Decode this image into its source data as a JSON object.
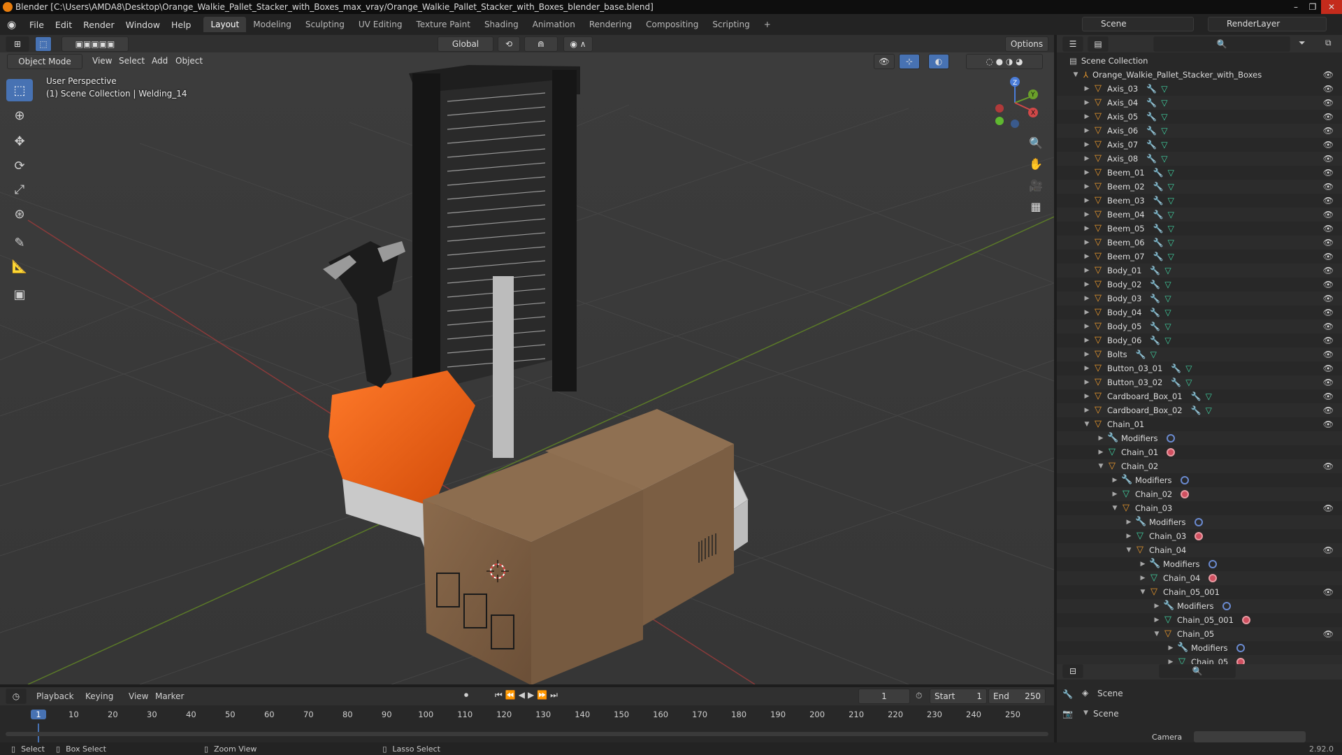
{
  "window": {
    "title": "Blender [C:\\Users\\AMDA8\\Desktop\\Orange_Walkie_Pallet_Stacker_with_Boxes_max_vray/Orange_Walkie_Pallet_Stacker_with_Boxes_blender_base.blend]",
    "controls": [
      "–",
      "❐",
      "✕"
    ]
  },
  "menu": [
    "File",
    "Edit",
    "Render",
    "Window",
    "Help"
  ],
  "workspaces": [
    "Layout",
    "Modeling",
    "Sculpting",
    "UV Editing",
    "Texture Paint",
    "Shading",
    "Animation",
    "Rendering",
    "Compositing",
    "Scripting"
  ],
  "active_workspace": "Layout",
  "scene_name": "Scene",
  "render_layer": "RenderLayer",
  "tool_header": {
    "orientation": "Global",
    "options_label": "Options"
  },
  "viewport_header": {
    "mode": "Object Mode",
    "menus": [
      "View",
      "Select",
      "Add",
      "Object"
    ]
  },
  "viewport": {
    "perspective_label": "User Perspective",
    "collection_label": "(1) Scene Collection | Welding_14",
    "gizmo_axes": [
      "Z",
      "Y",
      "X"
    ]
  },
  "outliner": {
    "root": "Scene Collection",
    "collection": "Orange_Walkie_Pallet_Stacker_with_Boxes",
    "rows": [
      {
        "label": "Axis_03",
        "kind": "obj",
        "level": 0,
        "open": false
      },
      {
        "label": "Axis_04",
        "kind": "obj",
        "level": 0,
        "open": false
      },
      {
        "label": "Axis_05",
        "kind": "obj",
        "level": 0,
        "open": false
      },
      {
        "label": "Axis_06",
        "kind": "obj",
        "level": 0,
        "open": false
      },
      {
        "label": "Axis_07",
        "kind": "obj",
        "level": 0,
        "open": false
      },
      {
        "label": "Axis_08",
        "kind": "obj",
        "level": 0,
        "open": false
      },
      {
        "label": "Beem_01",
        "kind": "obj",
        "level": 0,
        "open": false
      },
      {
        "label": "Beem_02",
        "kind": "obj",
        "level": 0,
        "open": false
      },
      {
        "label": "Beem_03",
        "kind": "obj",
        "level": 0,
        "open": false
      },
      {
        "label": "Beem_04",
        "kind": "obj",
        "level": 0,
        "open": false
      },
      {
        "label": "Beem_05",
        "kind": "obj",
        "level": 0,
        "open": false
      },
      {
        "label": "Beem_06",
        "kind": "obj",
        "level": 0,
        "open": false
      },
      {
        "label": "Beem_07",
        "kind": "obj",
        "level": 0,
        "open": false
      },
      {
        "label": "Body_01",
        "kind": "obj",
        "level": 0,
        "open": false
      },
      {
        "label": "Body_02",
        "kind": "obj",
        "level": 0,
        "open": false
      },
      {
        "label": "Body_03",
        "kind": "obj",
        "level": 0,
        "open": false
      },
      {
        "label": "Body_04",
        "kind": "obj",
        "level": 0,
        "open": false
      },
      {
        "label": "Body_05",
        "kind": "obj",
        "level": 0,
        "open": false
      },
      {
        "label": "Body_06",
        "kind": "obj",
        "level": 0,
        "open": false
      },
      {
        "label": "Bolts",
        "kind": "obj",
        "level": 0,
        "open": false
      },
      {
        "label": "Button_03_01",
        "kind": "obj",
        "level": 0,
        "open": false
      },
      {
        "label": "Button_03_02",
        "kind": "obj",
        "level": 0,
        "open": false
      },
      {
        "label": "Cardboard_Box_01",
        "kind": "obj",
        "level": 0,
        "open": false
      },
      {
        "label": "Cardboard_Box_02",
        "kind": "obj",
        "level": 0,
        "open": false
      },
      {
        "label": "Chain_01",
        "kind": "obj-open",
        "level": 0,
        "open": true
      },
      {
        "label": "Modifiers",
        "kind": "mods",
        "level": 1
      },
      {
        "label": "Chain_01",
        "kind": "mesh",
        "level": 1
      },
      {
        "label": "Chain_02",
        "kind": "obj-open",
        "level": 1,
        "open": true
      },
      {
        "label": "Modifiers",
        "kind": "mods",
        "level": 2
      },
      {
        "label": "Chain_02",
        "kind": "mesh",
        "level": 2
      },
      {
        "label": "Chain_03",
        "kind": "obj-open",
        "level": 2,
        "open": true
      },
      {
        "label": "Modifiers",
        "kind": "mods",
        "level": 3
      },
      {
        "label": "Chain_03",
        "kind": "mesh",
        "level": 3
      },
      {
        "label": "Chain_04",
        "kind": "obj-open",
        "level": 3,
        "open": true
      },
      {
        "label": "Modifiers",
        "kind": "mods",
        "level": 4
      },
      {
        "label": "Chain_04",
        "kind": "mesh",
        "level": 4
      },
      {
        "label": "Chain_05_001",
        "kind": "obj-open",
        "level": 4,
        "open": true
      },
      {
        "label": "Modifiers",
        "kind": "mods",
        "level": 5
      },
      {
        "label": "Chain_05_001",
        "kind": "mesh",
        "level": 5
      },
      {
        "label": "Chain_05",
        "kind": "obj-open",
        "level": 5,
        "open": true
      },
      {
        "label": "Modifiers",
        "kind": "mods",
        "level": 6
      },
      {
        "label": "Chain_05",
        "kind": "mesh",
        "level": 6
      }
    ]
  },
  "properties": {
    "header": "Scene",
    "section": "Scene",
    "camera_label": "Camera"
  },
  "timeline": {
    "menus": [
      "Playback",
      "Keying",
      "View",
      "Marker"
    ],
    "current_frame": "1",
    "start_label": "Start",
    "start": "1",
    "end_label": "End",
    "end": "250",
    "ticks": [
      "1",
      "10",
      "20",
      "30",
      "40",
      "50",
      "60",
      "70",
      "80",
      "90",
      "100",
      "110",
      "120",
      "130",
      "140",
      "150",
      "160",
      "170",
      "180",
      "190",
      "200",
      "210",
      "220",
      "230",
      "240",
      "250"
    ]
  },
  "statusbar": {
    "select": "Select",
    "box_select": "Box Select",
    "zoom_view": "Zoom View",
    "lasso_select": "Lasso Select",
    "version": "2.92.0"
  },
  "colors": {
    "accent": "#4772b3",
    "object_orange": "#e8972c",
    "mesh_green": "#40d0a0",
    "axis_red": "#c04848",
    "axis_green": "#6a9a2a"
  }
}
